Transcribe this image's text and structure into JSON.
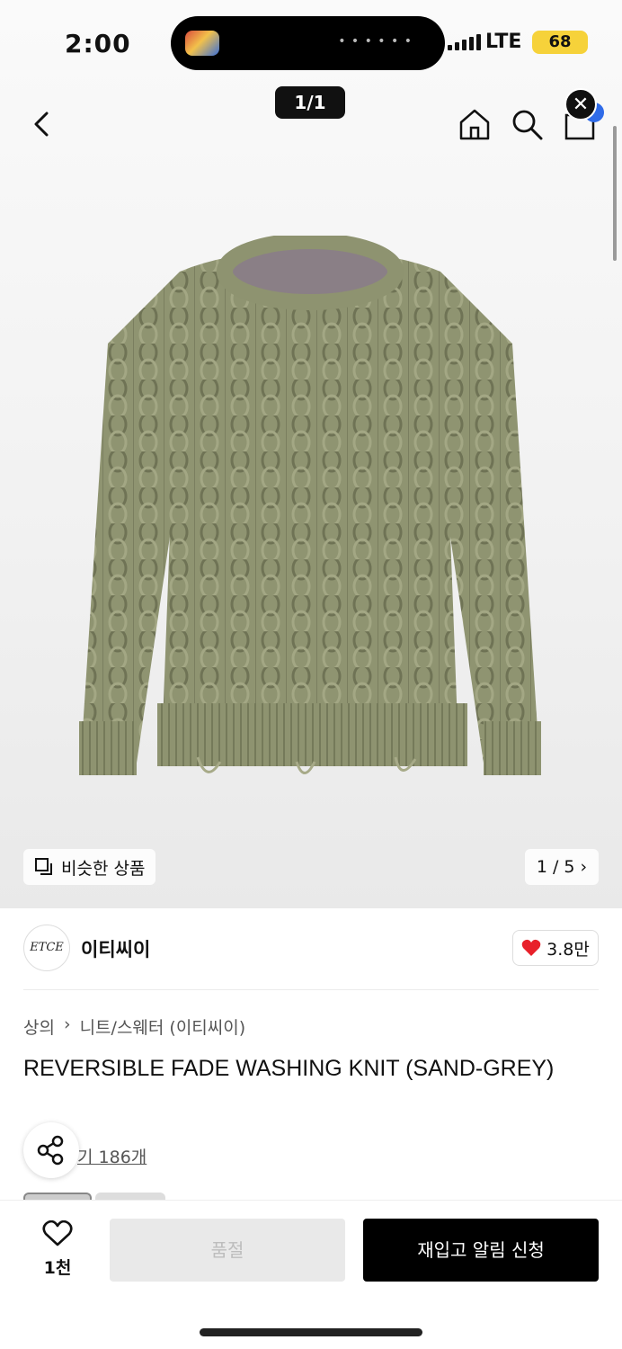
{
  "status_bar": {
    "time": "2:00",
    "network": "LTE",
    "battery": "68"
  },
  "gallery": {
    "counter": "1/1",
    "similar_label": "비슷한 상품",
    "page_indicator": "1 / 5"
  },
  "nav": {
    "back": "back",
    "home": "home",
    "search": "search",
    "cart": "cart"
  },
  "brand": {
    "logo_text": "ETCE",
    "name": "이티씨이",
    "likes": "3.8만"
  },
  "breadcrumb": [
    "상의",
    "니트/스웨터 (이티씨이)"
  ],
  "product": {
    "title": "REVERSIBLE FADE WASHING KNIT (SAND-GREY)",
    "reviews": "기 186개"
  },
  "bottom_bar": {
    "wish_count": "1천",
    "soldout_label": "품절",
    "restock_label": "재입고 알림 신청"
  },
  "colors": {
    "accent": "#000000",
    "heart": "#e8202a",
    "badge": "#2f6be8",
    "sweater": "#8f9471"
  }
}
